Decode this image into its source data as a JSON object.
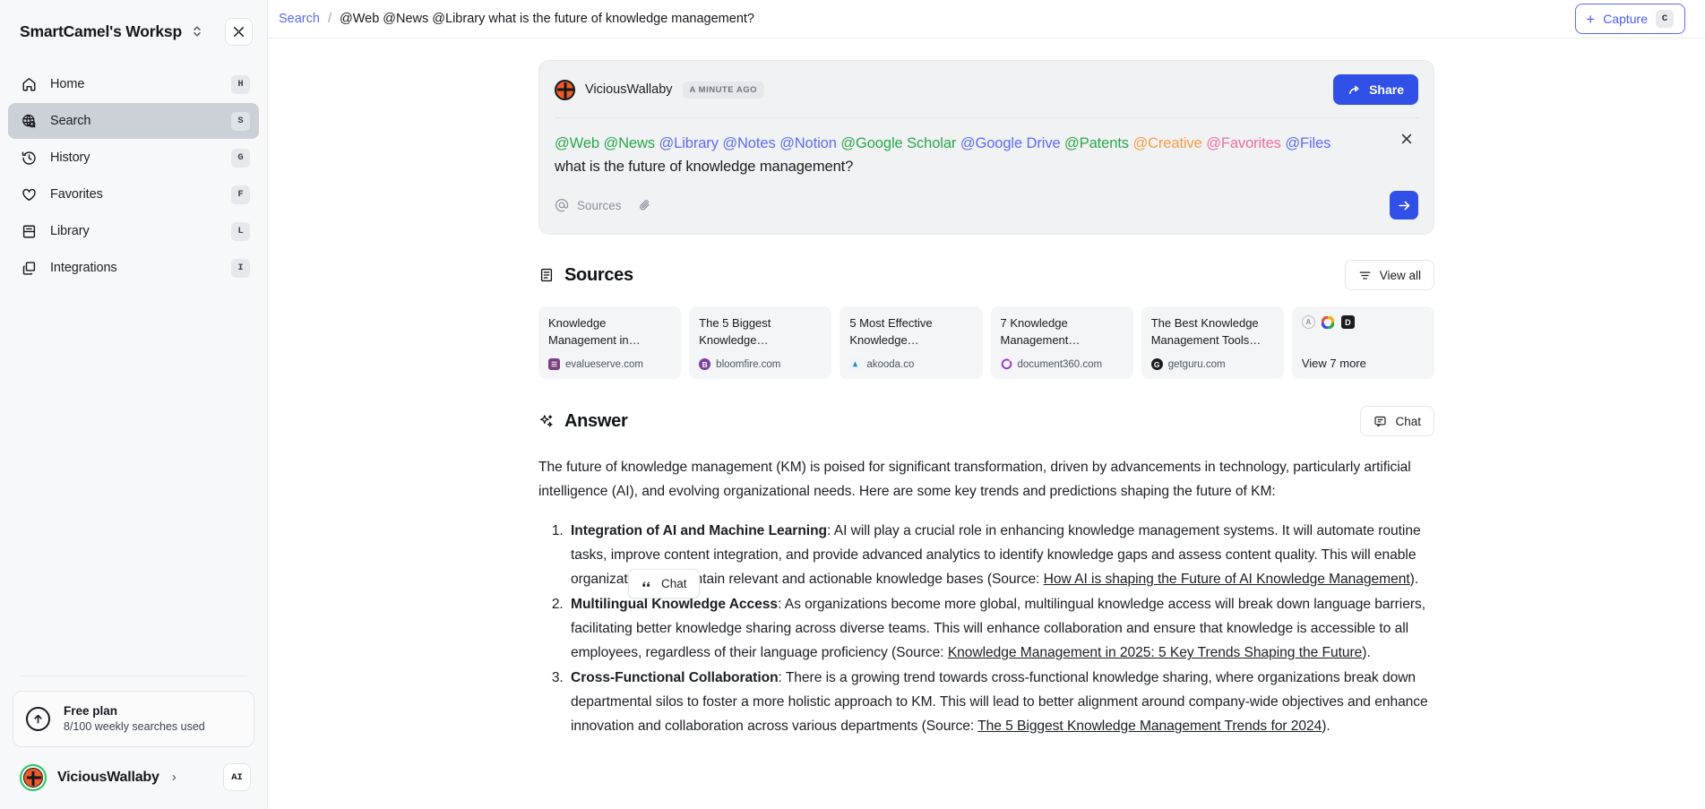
{
  "sidebar": {
    "workspace_title": "SmartCamel's Worksp",
    "collapse_icon": "collapse-panel-icon",
    "nav": [
      {
        "label": "Home",
        "key": "H",
        "icon": "home-icon"
      },
      {
        "label": "Search",
        "key": "S",
        "icon": "search-globe-icon",
        "active": true
      },
      {
        "label": "History",
        "key": "G",
        "icon": "history-clock-icon"
      },
      {
        "label": "Favorites",
        "key": "F",
        "icon": "heart-icon"
      },
      {
        "label": "Library",
        "key": "L",
        "icon": "book-icon"
      },
      {
        "label": "Integrations",
        "key": "I",
        "icon": "layers-icon"
      }
    ],
    "plan": {
      "name": "Free plan",
      "usage": "8/100 weekly searches used",
      "icon": "upgrade-arrow-icon"
    },
    "user": {
      "name": "ViciousWallaby",
      "chevron": "›",
      "ai_badge": "AI"
    }
  },
  "topbar": {
    "breadcrumb_root": "Search",
    "breadcrumb_sep": "/",
    "breadcrumb_current": "@Web @News @Library what is the future of knowledge management?",
    "capture_label": "Capture",
    "capture_key": "C",
    "capture_plus": "+"
  },
  "query_card": {
    "author": "ViciousWallaby",
    "time": "A MINUTE AGO",
    "share_label": "Share",
    "close_icon": "close-icon",
    "mentions": [
      {
        "text": "@Web",
        "color": "#2aa84a"
      },
      {
        "text": "@News",
        "color": "#2aa84a"
      },
      {
        "text": "@Library",
        "color": "#5b6cf5"
      },
      {
        "text": "@Notes",
        "color": "#5b6cf5"
      },
      {
        "text": "@Notion",
        "color": "#5b6cf5"
      },
      {
        "text": "@Google Scholar",
        "color": "#2aa84a"
      },
      {
        "text": "@Google Drive",
        "color": "#5b6cf5"
      },
      {
        "text": "@Patents",
        "color": "#2aa84a"
      },
      {
        "text": "@Creative",
        "color": "#f59e42"
      },
      {
        "text": "@Favorites",
        "color": "#ec6fa0"
      },
      {
        "text": "@Files",
        "color": "#5b6cf5"
      }
    ],
    "question": "what is the future of knowledge management?",
    "sources_label": "Sources",
    "sources_at_icon": "at-sign-icon",
    "attach_icon": "paperclip-icon",
    "send_icon": "arrow-right-icon"
  },
  "sources": {
    "heading": "Sources",
    "heading_icon": "list-document-icon",
    "view_all_label": "View all",
    "view_all_icon": "filter-lines-icon",
    "cards": [
      {
        "title": "Knowledge Management in…",
        "domain": "evalueserve.com",
        "favicon_letter": "E",
        "favicon_color": "#7b3f7f"
      },
      {
        "title": "The 5 Biggest Knowledge…",
        "domain": "bloomfire.com",
        "favicon_letter": "B",
        "favicon_color": "#7b3f9f"
      },
      {
        "title": "5 Most Effective Knowledge…",
        "domain": "akooda.co",
        "favicon_letter": "A",
        "favicon_color": "#2f7fe0"
      },
      {
        "title": "7 Knowledge Management…",
        "domain": "document360.com",
        "favicon_letter": "O",
        "favicon_color": "#9b2fc7"
      },
      {
        "title": "The Best Knowledge Management Tools…",
        "domain": "getguru.com",
        "favicon_letter": "G",
        "favicon_color": "#1c1c1c"
      }
    ],
    "more": {
      "label": "View 7 more",
      "icons": [
        {
          "letter": "A",
          "color": "#8d939d"
        },
        {
          "letter": "O",
          "color": "#e8532f"
        },
        {
          "letter": "D",
          "color": "#1c1c1c"
        }
      ]
    }
  },
  "answer": {
    "heading": "Answer",
    "heading_icon": "sparkles-icon",
    "chat_label": "Chat",
    "chat_icon": "chat-bubble-icon",
    "intro": "The future of knowledge management (KM) is poised for significant transformation, driven by advancements in technology, particularly artificial intelligence (AI), and evolving organizational needs. Here are some key trends and predictions shaping the future of KM:",
    "items": [
      {
        "term": "Integration of AI and Machine Learning",
        "body_before": ": AI will play a crucial role in enhancing knowledge management systems. It will automate routine tasks, improve content integration, and provide advanced analytics to identify knowledge gaps and assess content quality. This will enable organizations to maintain relevant and actionable knowledge bases (Source: ",
        "link": "How AI is shaping the Future of AI Knowledge Management",
        "body_after": ")."
      },
      {
        "term": "Multilingual Knowledge Access",
        "body_before": ": As organizations become more global, multilingual knowledge access will break down language barriers, facilitating better knowledge sharing across diverse teams. This will enhance collaboration and ensure that knowledge is accessible to all employees, regardless of their language proficiency (Source: ",
        "link": "Knowledge Management in 2025: 5 Key Trends Shaping the Future",
        "body_after": ")."
      },
      {
        "term": "Cross-Functional Collaboration",
        "body_before": ": There is a growing trend towards cross-functional knowledge sharing, where organizations break down departmental silos to foster a more holistic approach to KM. This will lead to better alignment around company-wide objectives and enhance innovation and collaboration across various departments (Source: ",
        "link": "The 5 Biggest Knowledge Management Trends for 2024",
        "body_after": ")."
      }
    ]
  },
  "chat_tooltip": {
    "label": "Chat",
    "icon": "quote-icon"
  },
  "colors": {
    "accent_blue": "#3050e8",
    "link_blue": "#5b6cf5",
    "sidebar_bg": "#f7f8f9",
    "card_bg": "#f1f2f4",
    "active_nav": "#ccd0d7"
  }
}
